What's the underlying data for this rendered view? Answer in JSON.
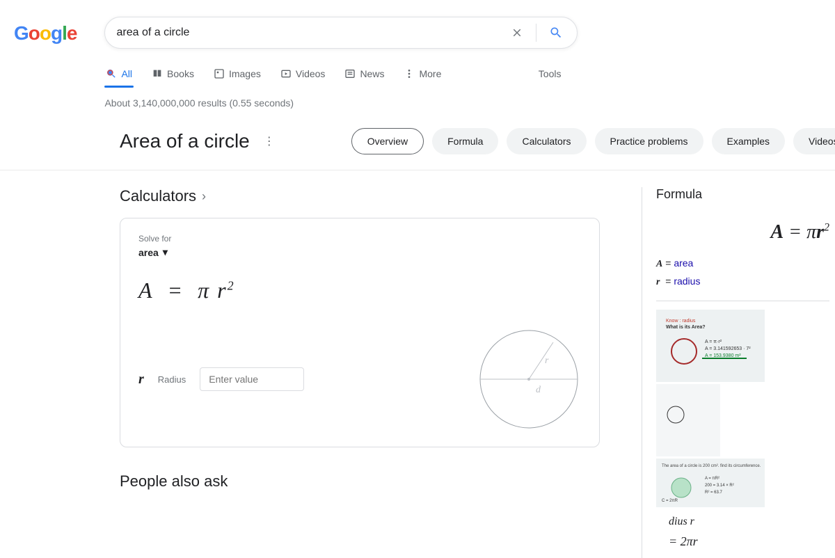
{
  "logo_letters": [
    "G",
    "o",
    "o",
    "g",
    "l",
    "e"
  ],
  "search": {
    "query": "area of a circle"
  },
  "tabs": {
    "all": "All",
    "books": "Books",
    "images": "Images",
    "videos": "Videos",
    "news": "News",
    "more": "More",
    "tools": "Tools"
  },
  "stats": "About 3,140,000,000 results (0.55 seconds)",
  "topic": {
    "title": "Area of a circle",
    "chips": [
      "Overview",
      "Formula",
      "Calculators",
      "Practice problems",
      "Examples",
      "Videos"
    ]
  },
  "sections": {
    "calculators": "Calculators",
    "paa": "People also ask"
  },
  "calc": {
    "solve_label": "Solve for",
    "solve_value": "area",
    "formula_html": "A  =  π r²",
    "var_symbol": "r",
    "var_label": "Radius",
    "placeholder": "Enter value",
    "diagram": {
      "r": "r",
      "d": "d"
    }
  },
  "side": {
    "title": "Formula",
    "formula": "A = πr²",
    "legend": [
      {
        "sym": "A",
        "label": "area"
      },
      {
        "sym": "r",
        "label": "radius"
      }
    ]
  }
}
